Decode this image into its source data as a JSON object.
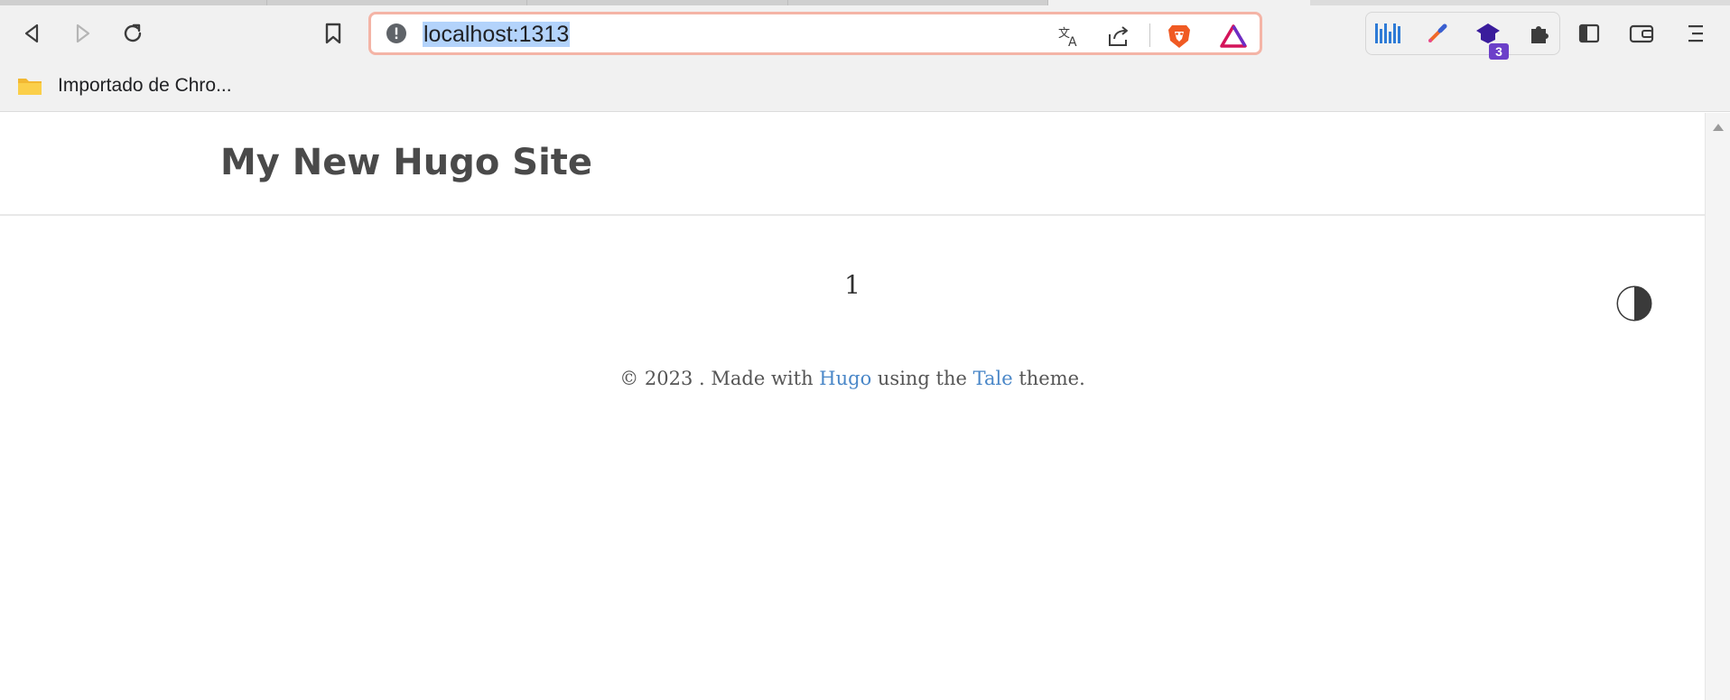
{
  "browser": {
    "address_bar": {
      "url": "localhost:1313"
    },
    "bookmarks_bar": {
      "items": [
        {
          "label": "Importado de Chro..."
        }
      ]
    },
    "extensions": {
      "badge_count": "3"
    },
    "colors": {
      "url_highlight": "#b3d3fb",
      "omnibox_border": "#f4b4a6",
      "badge": "#6c40c9"
    }
  },
  "page": {
    "site_title": "My New Hugo Site",
    "pagination": {
      "current": "1"
    },
    "footer": {
      "prefix": "© 2023 . Made with ",
      "hugo_link": "Hugo",
      "middle": " using the ",
      "tale_link": "Tale",
      "suffix": " theme."
    },
    "colors": {
      "title": "#4a4a4a",
      "link": "#4a87c8",
      "text": "#555555"
    }
  }
}
